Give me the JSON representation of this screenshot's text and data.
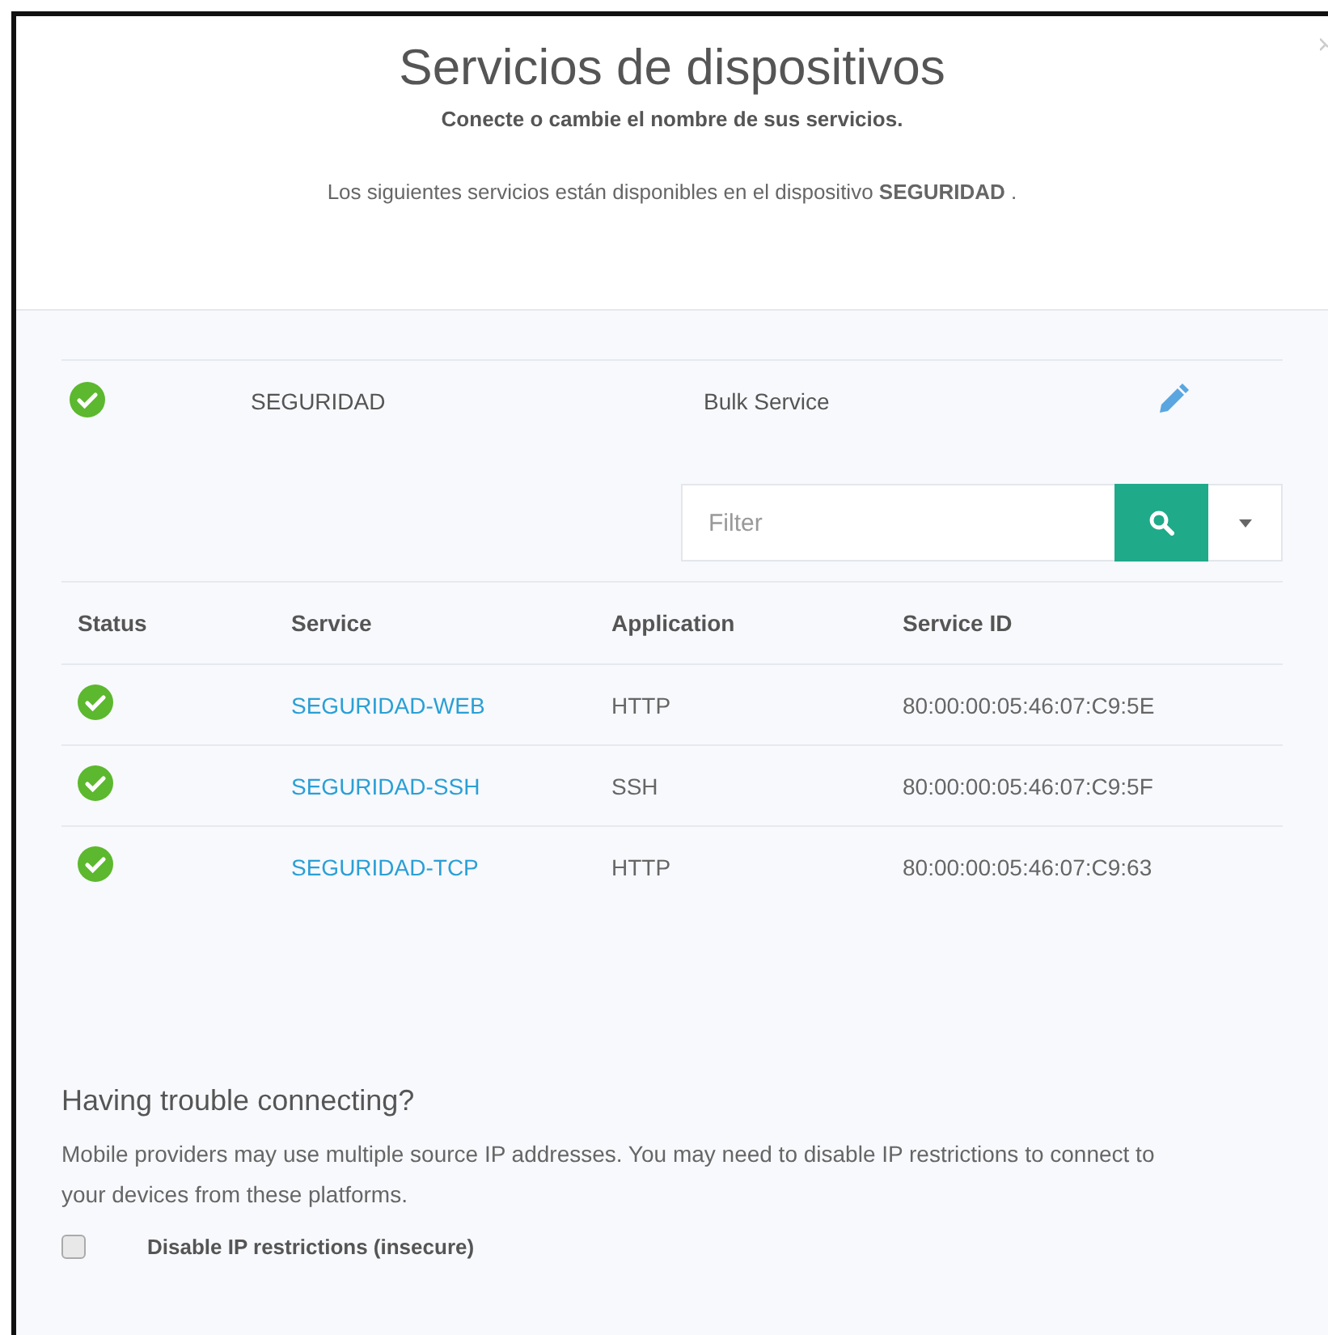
{
  "header": {
    "title": "Servicios de dispositivos",
    "subtitle": "Conecte o cambie el nombre de sus servicios.",
    "description": "Los siguientes servicios están disponibles en el dispositivo **SEGURIDAD** ."
  },
  "device": {
    "connected": true,
    "name": "SEGURIDAD",
    "type": "Bulk Service"
  },
  "filter": {
    "placeholder": "Filter"
  },
  "table": {
    "columns": [
      "Status",
      "Service",
      "Application",
      "Service ID"
    ],
    "rows": [
      {
        "connected": true,
        "service": "SEGURIDAD-WEB",
        "application": "HTTP",
        "service_id": "80:00:00:05:46:07:C9:5E"
      },
      {
        "connected": true,
        "service": "SEGURIDAD-SSH",
        "application": "SSH",
        "service_id": "80:00:00:05:46:07:C9:5F"
      },
      {
        "connected": true,
        "service": "SEGURIDAD-TCP",
        "application": "HTTP",
        "service_id": "80:00:00:05:46:07:C9:63"
      }
    ]
  },
  "help": {
    "title": "Having trouble connecting?",
    "text": "Mobile providers may use multiple source IP addresses. You may need to disable IP restrictions to connect to your devices from these platforms.",
    "checkbox": {
      "label": "Disable IP restrictions (insecure)",
      "checked": false
    }
  }
}
